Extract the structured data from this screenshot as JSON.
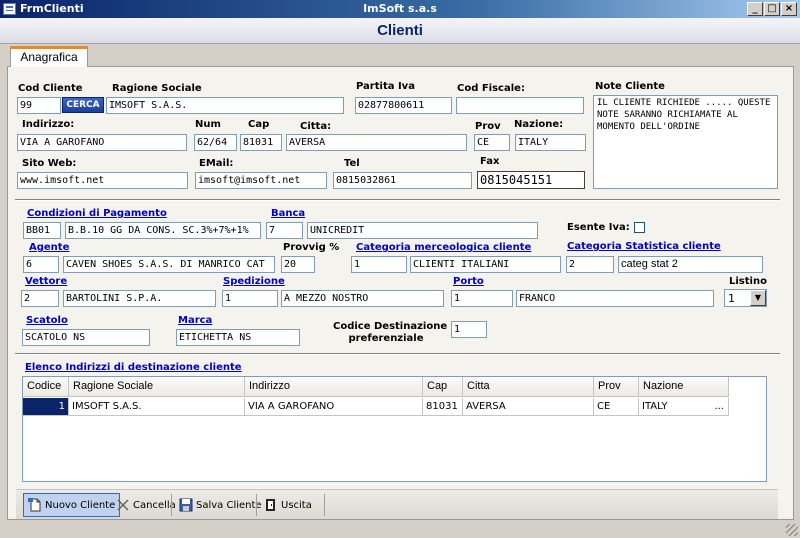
{
  "window": {
    "title": "FrmClienti",
    "company": "ImSoft s.a.s",
    "buttons": {
      "minimize": "_",
      "maximize": "□",
      "close": "×"
    }
  },
  "header": {
    "title": "Clienti"
  },
  "tabs": [
    {
      "label": "Anagrafica"
    }
  ],
  "fields": {
    "cod_cliente": {
      "label": "Cod Cliente",
      "value": "99"
    },
    "cerca": {
      "label": "CERCA"
    },
    "ragione_sociale": {
      "label": "Ragione Sociale",
      "value": "IMSOFT S.A.S."
    },
    "partita_iva": {
      "label": "Partita Iva",
      "value": "02877800611"
    },
    "codice_fiscale": {
      "label": "Cod Fiscale:",
      "value": ""
    },
    "note_cliente": {
      "label": "Note Cliente",
      "value": "IL CLIENTE RICHIEDE ..... QUESTE NOTE SARANNO RICHIAMATE AL MOMENTO DELL'ORDINE"
    },
    "indirizzo": {
      "label": "Indirizzo:",
      "value": "VIA A GAROFANO"
    },
    "num": {
      "label": "Num",
      "value": "62/64"
    },
    "cap": {
      "label": "Cap",
      "value": "81031"
    },
    "citta": {
      "label": "Citta:",
      "value": "AVERSA"
    },
    "prov": {
      "label": "Prov",
      "value": "CE"
    },
    "nazione": {
      "label": "Nazione:",
      "value": "ITALY"
    },
    "sito_web": {
      "label": "Sito Web:",
      "value": "www.imsoft.net"
    },
    "email": {
      "label": "EMail:",
      "value": "imsoft@imsoft.net"
    },
    "tel": {
      "label": "Tel",
      "value": "0815032861"
    },
    "fax": {
      "label": "Fax",
      "value": "0815045151"
    },
    "condizioni_pagamento": {
      "label": "Condizioni di Pagamento",
      "code": "BB01",
      "value": "B.B.10 GG DA CONS. SC.3%+7%+1%"
    },
    "banca": {
      "label": "Banca",
      "code": "7",
      "value": "UNICREDIT"
    },
    "esente_iva": {
      "label": "Esente Iva:"
    },
    "agente": {
      "label": "Agente",
      "code": "6",
      "value": "CAVEN SHOES S.A.S. DI MANRICO CAT"
    },
    "provvig": {
      "label": "Provvig %",
      "value": "20"
    },
    "cat_merceologica": {
      "label": "Categoria merceologica cliente",
      "code": "1",
      "value": "CLIENTI ITALIANI"
    },
    "cat_statistica": {
      "label": "Categoria Statistica cliente",
      "code": "2",
      "value": "categ stat 2"
    },
    "vettore": {
      "label": "Vettore",
      "code": "2",
      "value": "BARTOLINI S.P.A."
    },
    "spedizione": {
      "label": "Spedizione",
      "code": "1",
      "value": "A MEZZO NOSTRO"
    },
    "porto": {
      "label": "Porto",
      "code": "1",
      "value": "FRANCO"
    },
    "listino": {
      "label": "Listino",
      "value": "1"
    },
    "scatolo": {
      "label": "Scatolo",
      "value": "SCATOLO NS"
    },
    "marca": {
      "label": "Marca",
      "value": "ETICHETTA NS"
    },
    "codice_destinazione": {
      "label_line1": "Codice Destinazione",
      "label_line2": "preferenziale",
      "value": "1"
    }
  },
  "destinations": {
    "title": "Elenco Indirizzi di destinazione cliente",
    "columns": [
      "Codice",
      "Ragione Sociale",
      "Indirizzo",
      "Cap",
      "Citta",
      "Prov",
      "Nazione"
    ],
    "rows": [
      [
        "1",
        "IMSOFT S.A.S.",
        "VIA A GAROFANO",
        "81031",
        "AVERSA",
        "CE",
        "ITALY"
      ]
    ],
    "ellipsis": "..."
  },
  "toolbar": {
    "nuovo": "Nuovo Cliente",
    "cancella": "Cancella",
    "salva": "Salva Cliente",
    "uscita": "Uscita"
  }
}
